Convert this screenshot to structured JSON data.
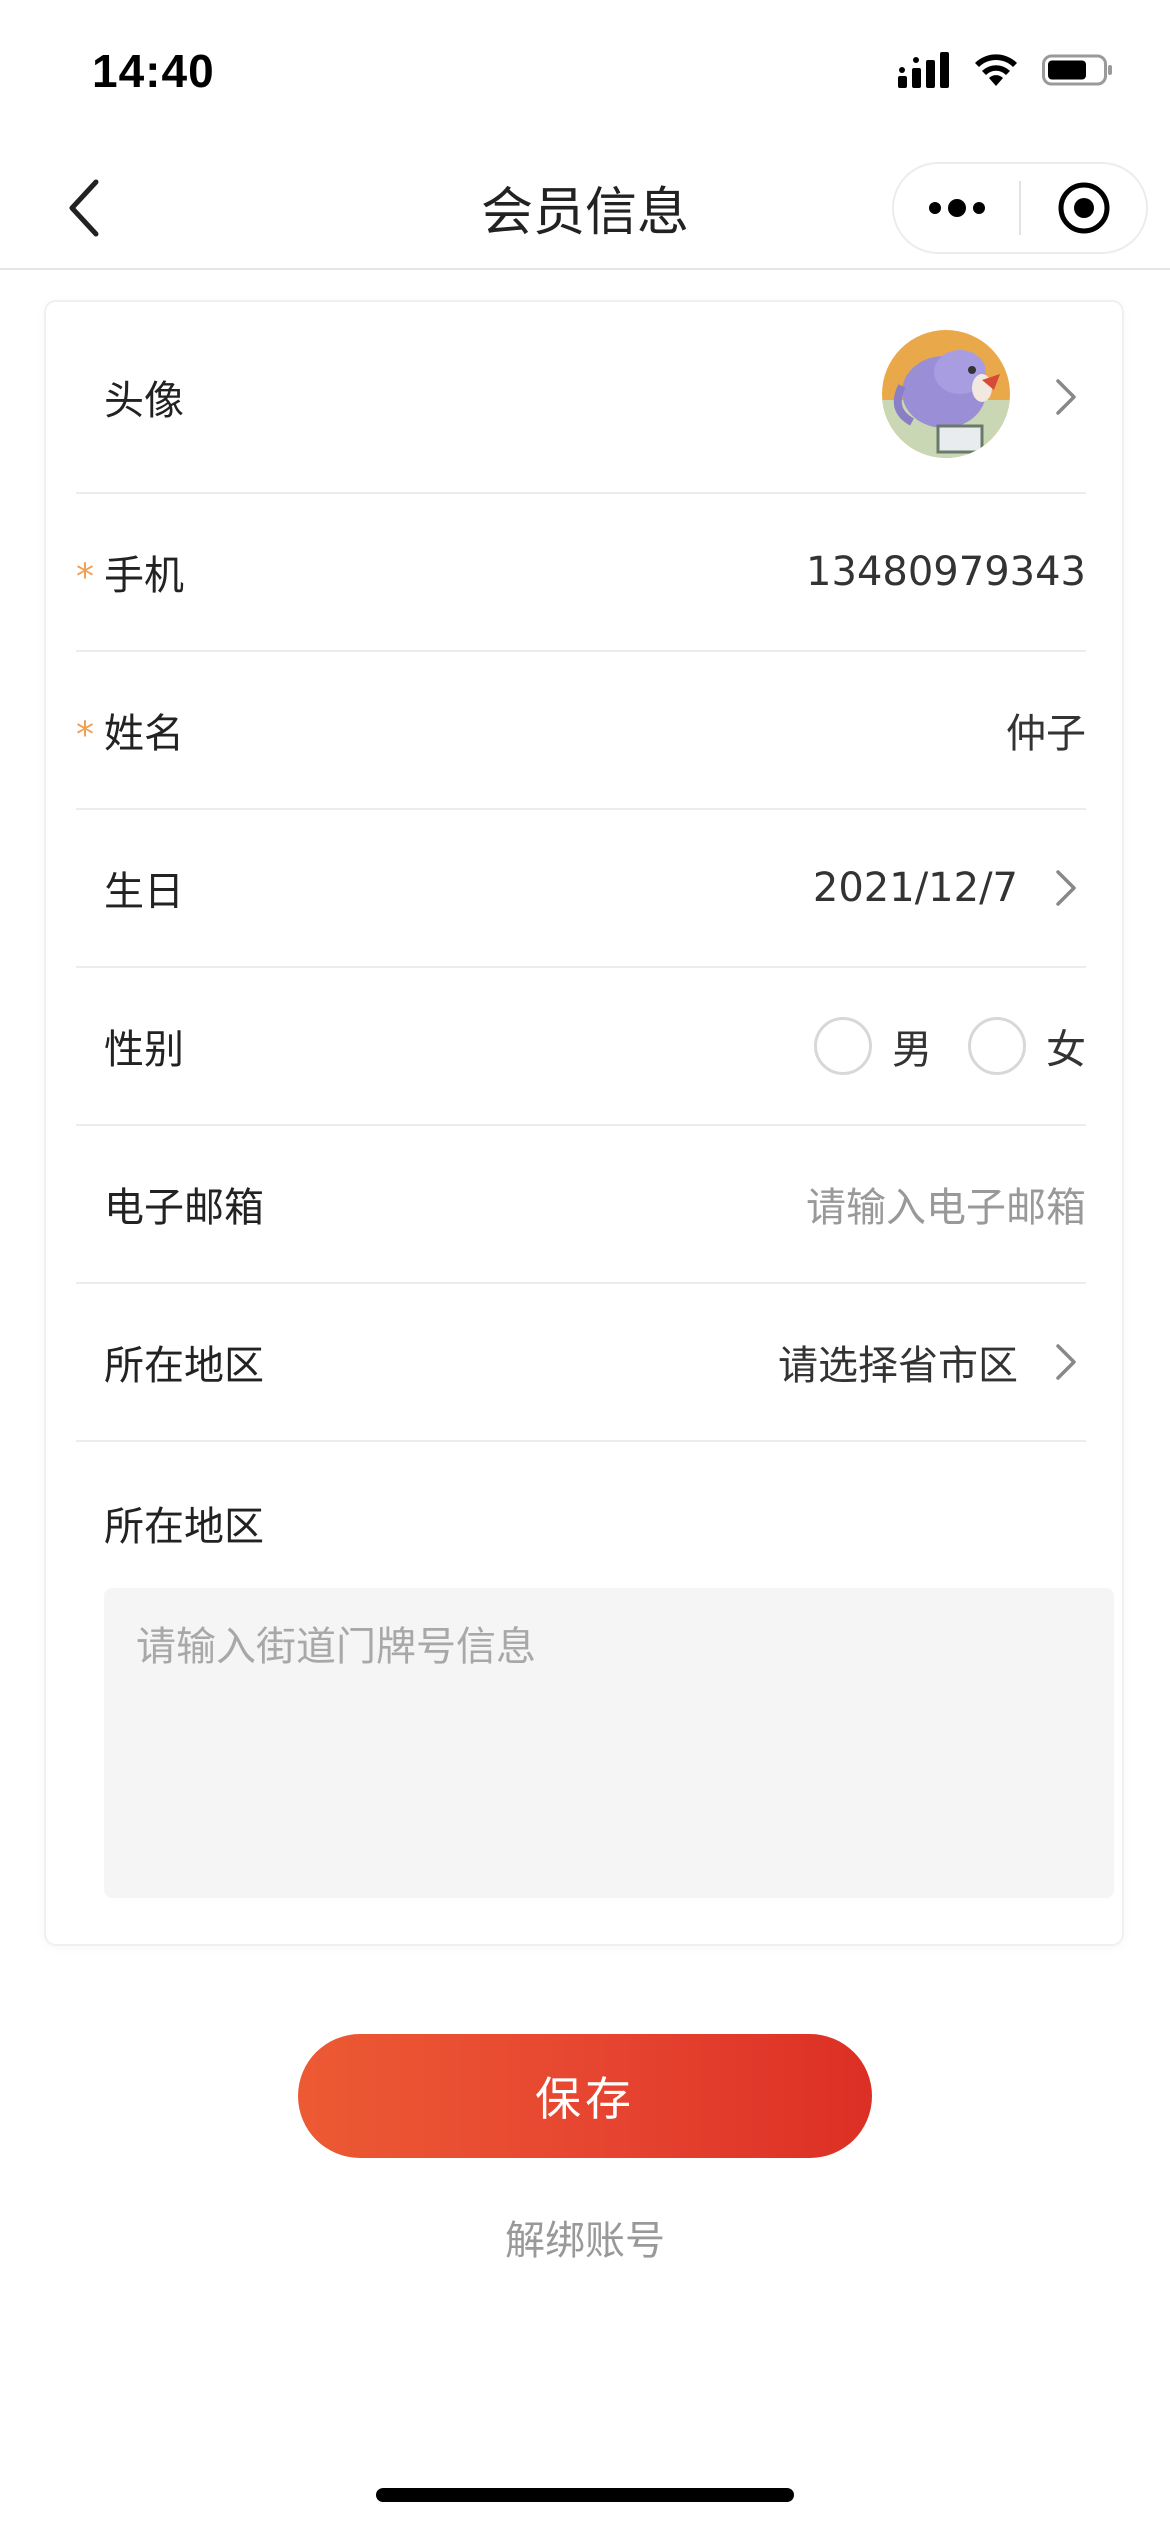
{
  "status_bar": {
    "time": "14:40"
  },
  "nav": {
    "title": "会员信息"
  },
  "form": {
    "avatar_label": "头像",
    "phone": {
      "required_mark": "*",
      "label": "手机",
      "value": "13480979343"
    },
    "name": {
      "required_mark": "*",
      "label": "姓名",
      "value": "仲子"
    },
    "birthday": {
      "label": "生日",
      "value": "2021/12/7"
    },
    "gender": {
      "label": "性别",
      "options": [
        "男",
        "女"
      ],
      "selected": null
    },
    "email": {
      "label": "电子邮箱",
      "placeholder": "请输入电子邮箱"
    },
    "region": {
      "label": "所在地区",
      "placeholder": "请选择省市区"
    },
    "address": {
      "label": "所在地区",
      "placeholder": "请输入街道门牌号信息"
    }
  },
  "actions": {
    "save_label": "保存",
    "unbind_label": "解绑账号"
  },
  "colors": {
    "accent_start": "#ec5a33",
    "accent_end": "#dc2f25",
    "required": "#f0a050",
    "placeholder": "#999999"
  }
}
